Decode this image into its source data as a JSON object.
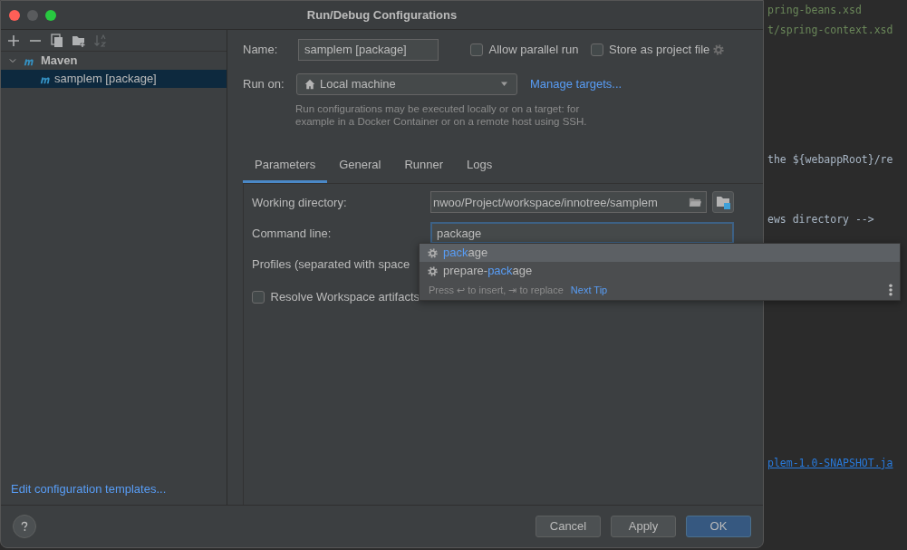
{
  "window": {
    "title": "Run/Debug Configurations"
  },
  "toolbar": [
    {
      "kind": "add",
      "disabled": false
    },
    {
      "kind": "remove",
      "disabled": false
    },
    {
      "kind": "copy",
      "disabled": false
    },
    {
      "kind": "folder",
      "disabled": false
    },
    {
      "kind": "sort",
      "disabled": true
    }
  ],
  "tree": [
    {
      "label": "Maven",
      "expanded": true,
      "selected": false,
      "children": [
        {
          "label": "samplem [package]",
          "selected": true
        }
      ]
    }
  ],
  "edit_templates_link": "Edit configuration templates...",
  "form": {
    "name_label": "Name:",
    "name_value": "samplem [package]",
    "options": [
      {
        "label": "Allow parallel run",
        "checked": false
      },
      {
        "label": "Store as project file",
        "checked": false
      }
    ],
    "run_on_label": "Run on:",
    "run_on_value": "Local machine",
    "manage_targets": "Manage targets...",
    "hint": "Run configurations may be executed locally or on a target: for example in a Docker Container or on a remote host using SSH."
  },
  "tabs": [
    {
      "label": "Parameters",
      "selected": true
    },
    {
      "label": "General",
      "selected": false
    },
    {
      "label": "Runner",
      "selected": false
    },
    {
      "label": "Logs",
      "selected": false
    }
  ],
  "parameters": {
    "working_directory_label": "Working directory:",
    "working_directory_value": "nwoo/Project/workspace/innotree/samplem",
    "command_line_label": "Command line:",
    "command_line_value": "package",
    "profiles_label": "Profiles (separated with space",
    "resolve_workspace": {
      "label": "Resolve Workspace artifacts",
      "checked": false
    }
  },
  "completion": {
    "items": [
      {
        "match": "pack",
        "suffix": "age",
        "selected": true
      },
      {
        "prefix": "prepare-",
        "match": "pack",
        "suffix": "age",
        "selected": false
      }
    ],
    "hint": "Press ↩ to insert, ⇥ to replace",
    "next_tip": "Next Tip"
  },
  "buttons": [
    {
      "label": "Cancel",
      "default": false
    },
    {
      "label": "Apply",
      "default": false
    },
    {
      "label": "OK",
      "default": true
    }
  ],
  "editor_lines": [
    {
      "text": "pring-beans.xsd",
      "kind": "string"
    },
    {
      "text": "t/spring-context.xsd",
      "kind": "string"
    },
    {
      "text": "the ${webappRoot}/re",
      "kind": "code"
    },
    {
      "text": "ews directory -->",
      "kind": "code"
    },
    {
      "text": "plem-1.0-SNAPSHOT.ja",
      "kind": "link"
    }
  ]
}
